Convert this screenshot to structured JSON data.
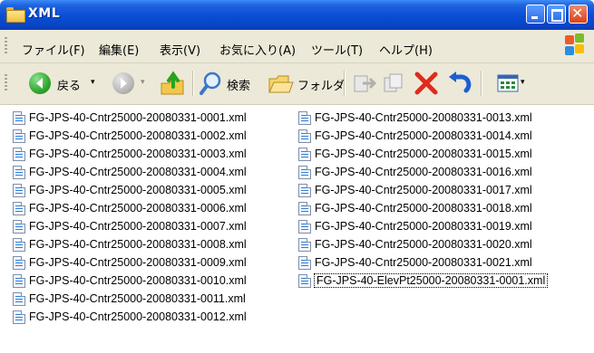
{
  "window": {
    "title": "XML"
  },
  "menu": [
    "ファイル(F)",
    "編集(E)",
    "表示(V)",
    "お気に入り(A)",
    "ツール(T)",
    "ヘルプ(H)"
  ],
  "toolbar": {
    "back_label": "戻る",
    "search_label": "検索",
    "folders_label": "フォルダ"
  },
  "icons": {
    "back": "back-arrow-icon",
    "forward": "forward-arrow-icon",
    "up": "up-folder-icon",
    "search": "magnifier-icon",
    "folders": "folders-icon",
    "move": "move-to-icon",
    "copy": "copy-to-icon",
    "delete": "delete-x-icon",
    "undo": "undo-icon",
    "views": "views-icon"
  },
  "colors": {
    "titlebar": "#0a4fd6",
    "menubar": "#ece9d8",
    "close": "#d9421c",
    "back": "#2fa82f",
    "delete": "#e02a1e"
  },
  "files": {
    "column1": [
      "FG-JPS-40-Cntr25000-20080331-0001.xml",
      "FG-JPS-40-Cntr25000-20080331-0002.xml",
      "FG-JPS-40-Cntr25000-20080331-0003.xml",
      "FG-JPS-40-Cntr25000-20080331-0004.xml",
      "FG-JPS-40-Cntr25000-20080331-0005.xml",
      "FG-JPS-40-Cntr25000-20080331-0006.xml",
      "FG-JPS-40-Cntr25000-20080331-0007.xml",
      "FG-JPS-40-Cntr25000-20080331-0008.xml",
      "FG-JPS-40-Cntr25000-20080331-0009.xml",
      "FG-JPS-40-Cntr25000-20080331-0010.xml",
      "FG-JPS-40-Cntr25000-20080331-0011.xml",
      "FG-JPS-40-Cntr25000-20080331-0012.xml"
    ],
    "column2": [
      "FG-JPS-40-Cntr25000-20080331-0013.xml",
      "FG-JPS-40-Cntr25000-20080331-0014.xml",
      "FG-JPS-40-Cntr25000-20080331-0015.xml",
      "FG-JPS-40-Cntr25000-20080331-0016.xml",
      "FG-JPS-40-Cntr25000-20080331-0017.xml",
      "FG-JPS-40-Cntr25000-20080331-0018.xml",
      "FG-JPS-40-Cntr25000-20080331-0019.xml",
      "FG-JPS-40-Cntr25000-20080331-0020.xml",
      "FG-JPS-40-Cntr25000-20080331-0021.xml",
      "FG-JPS-40-ElevPt25000-20080331-0001.xml"
    ]
  }
}
